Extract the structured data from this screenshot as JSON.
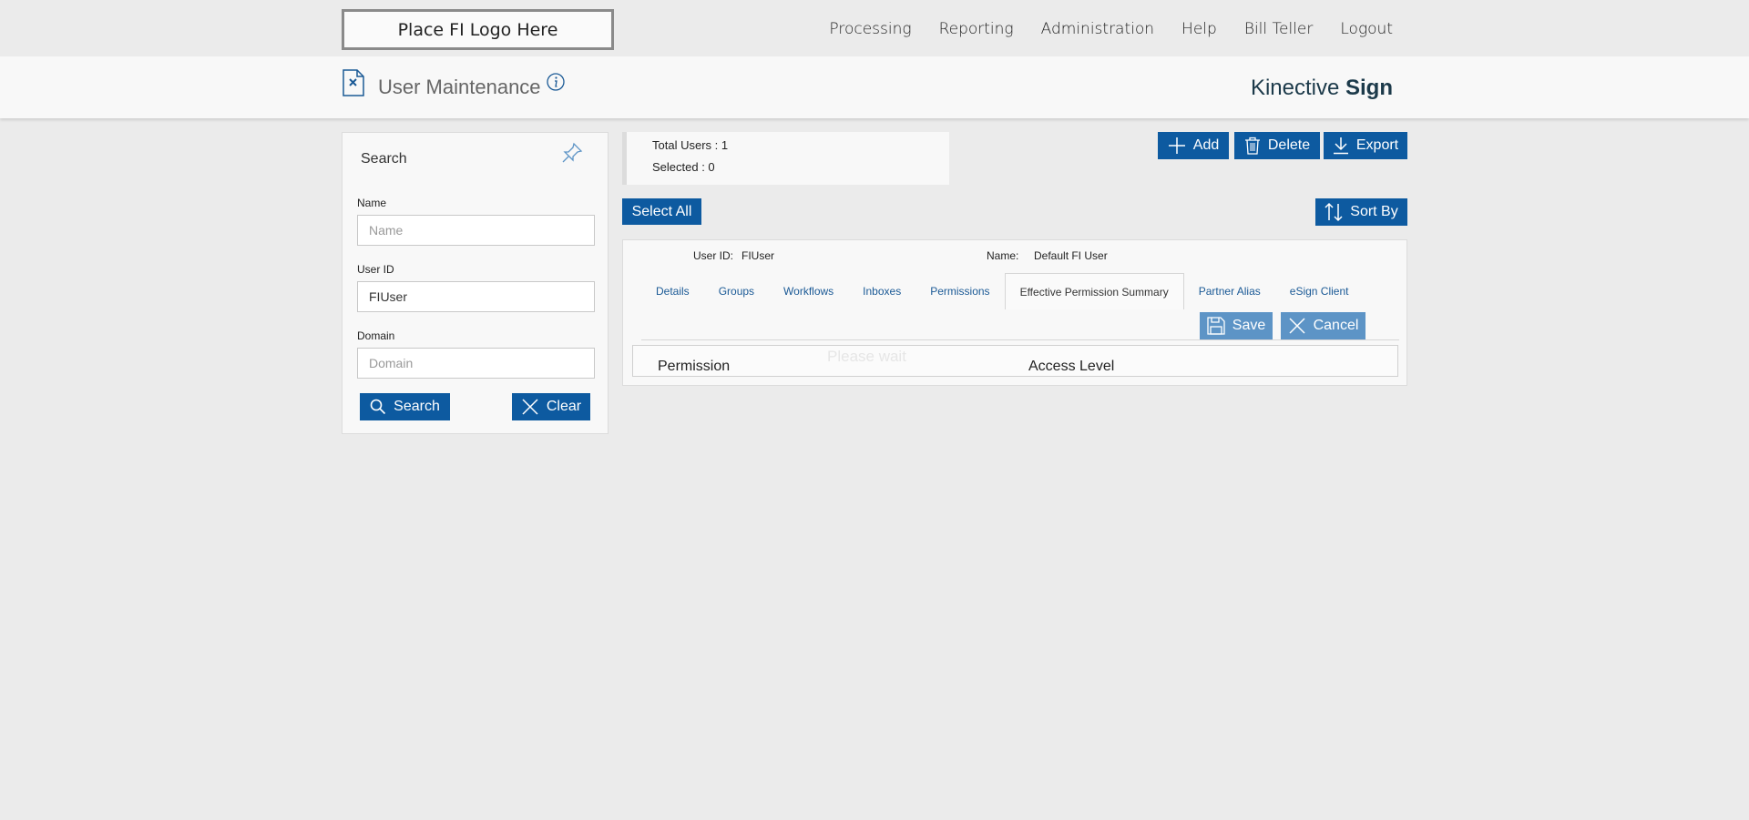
{
  "topbar": {
    "logo": "Place FI Logo Here",
    "nav": [
      "Processing",
      "Reporting",
      "Administration",
      "Help",
      "Bill Teller",
      "Logout"
    ]
  },
  "header": {
    "title": "User Maintenance",
    "brand_light": "Kinective",
    "brand_bold": "Sign"
  },
  "search": {
    "title": "Search",
    "name_label": "Name",
    "name_placeholder": "Name",
    "name_value": "",
    "userid_label": "User ID",
    "userid_value": "FIUser",
    "domain_label": "Domain",
    "domain_placeholder": "Domain",
    "domain_value": "",
    "search_button": "Search",
    "clear_button": "Clear"
  },
  "summary": {
    "total_users": "Total Users : 1",
    "selected": "Selected : 0"
  },
  "actions": {
    "add": "Add",
    "delete": "Delete",
    "export": "Export",
    "select_all": "Select All",
    "sort_by": "Sort By"
  },
  "detail": {
    "userid_label": "User ID:",
    "userid_value": "FIUser",
    "name_label": "Name:",
    "name_value": "Default FI User",
    "tabs": [
      "Details",
      "Groups",
      "Workflows",
      "Inboxes",
      "Permissions",
      "Effective Permission Summary",
      "Partner Alias",
      "eSign Client"
    ],
    "active_tab": "Effective Permission Summary",
    "save": "Save",
    "cancel": "Cancel",
    "ghost_text": "Please wait",
    "col_permission": "Permission",
    "col_access": "Access Level"
  },
  "colors": {
    "primary": "#0d5aa0",
    "primary_light": "#5d94c6",
    "link": "#1b5a96",
    "background": "#ebebeb"
  }
}
